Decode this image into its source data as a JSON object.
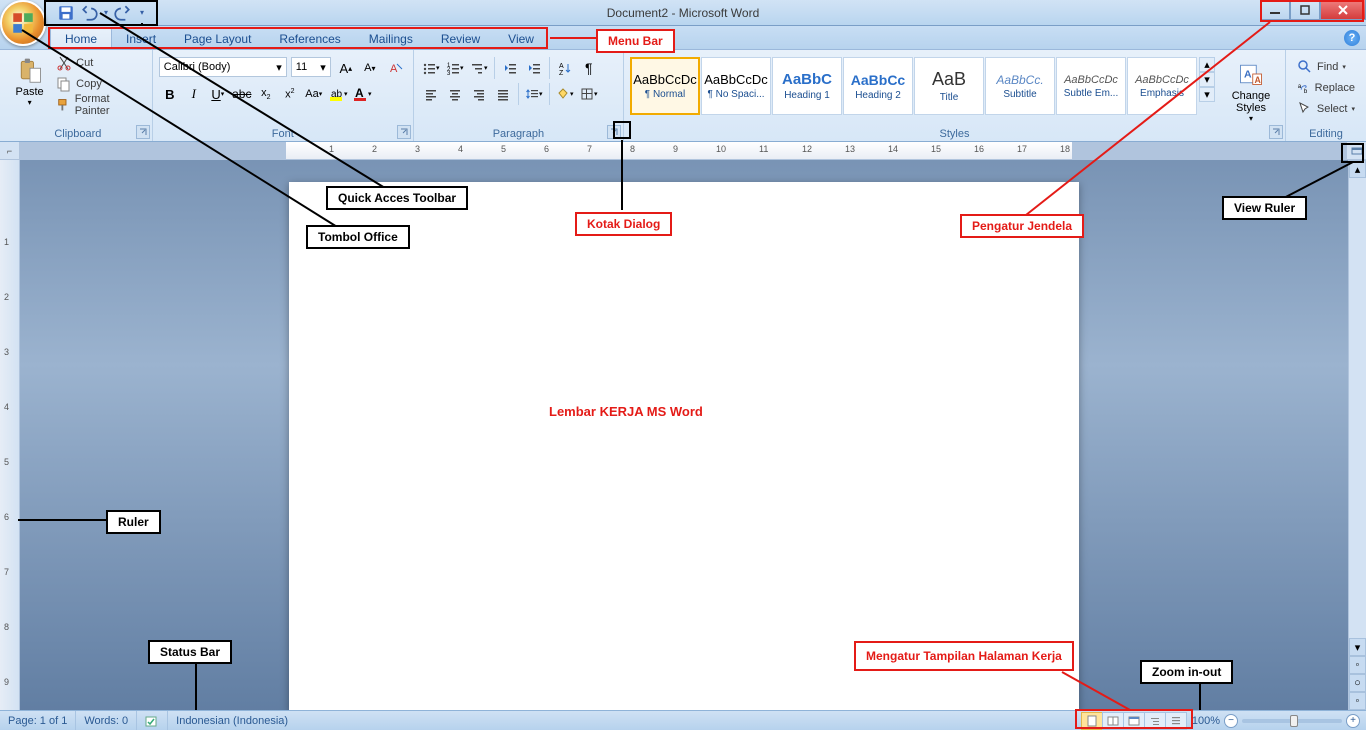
{
  "titlebar": {
    "title": "Document2 - Microsoft Word"
  },
  "tabs": [
    "Home",
    "Insert",
    "Page Layout",
    "References",
    "Mailings",
    "Review",
    "View"
  ],
  "ribbon": {
    "clipboard": {
      "title": "Clipboard",
      "paste": "Paste",
      "cut": "Cut",
      "copy": "Copy",
      "painter": "Format Painter"
    },
    "font": {
      "title": "Font",
      "name": "Calibri (Body)",
      "size": "11"
    },
    "paragraph": {
      "title": "Paragraph"
    },
    "styles": {
      "title": "Styles",
      "items": [
        {
          "preview": "AaBbCcDc",
          "name": "¶ Normal",
          "cls": ""
        },
        {
          "preview": "AaBbCcDc",
          "name": "¶ No Spaci...",
          "cls": ""
        },
        {
          "preview": "AaBbC",
          "name": "Heading 1",
          "cls": "h1"
        },
        {
          "preview": "AaBbCc",
          "name": "Heading 2",
          "cls": "h2"
        },
        {
          "preview": "AaB",
          "name": "Title",
          "cls": "title"
        },
        {
          "preview": "AaBbCc.",
          "name": "Subtitle",
          "cls": "sub"
        },
        {
          "preview": "AaBbCcDc",
          "name": "Subtle Em...",
          "cls": "em"
        },
        {
          "preview": "AaBbCcDc",
          "name": "Emphasis",
          "cls": "em"
        }
      ],
      "change": "Change Styles"
    },
    "editing": {
      "title": "Editing",
      "find": "Find",
      "replace": "Replace",
      "select": "Select"
    }
  },
  "status": {
    "page": "Page: 1 of 1",
    "words": "Words: 0",
    "lang": "Indonesian (Indonesia)",
    "zoom": "100%"
  },
  "annotations": {
    "menubar": "Menu Bar",
    "qat": "Quick Acces Toolbar",
    "office": "Tombol Office",
    "dialog": "Kotak Dialog",
    "window": "Pengatur Jendela",
    "view_ruler": "View Ruler",
    "doc": "Lembar KERJA MS Word",
    "ruler": "Ruler",
    "statusbar": "Status Bar",
    "view_page": "Mengatur Tampilan Halaman Kerja",
    "zoom": "Zoom in-out"
  }
}
